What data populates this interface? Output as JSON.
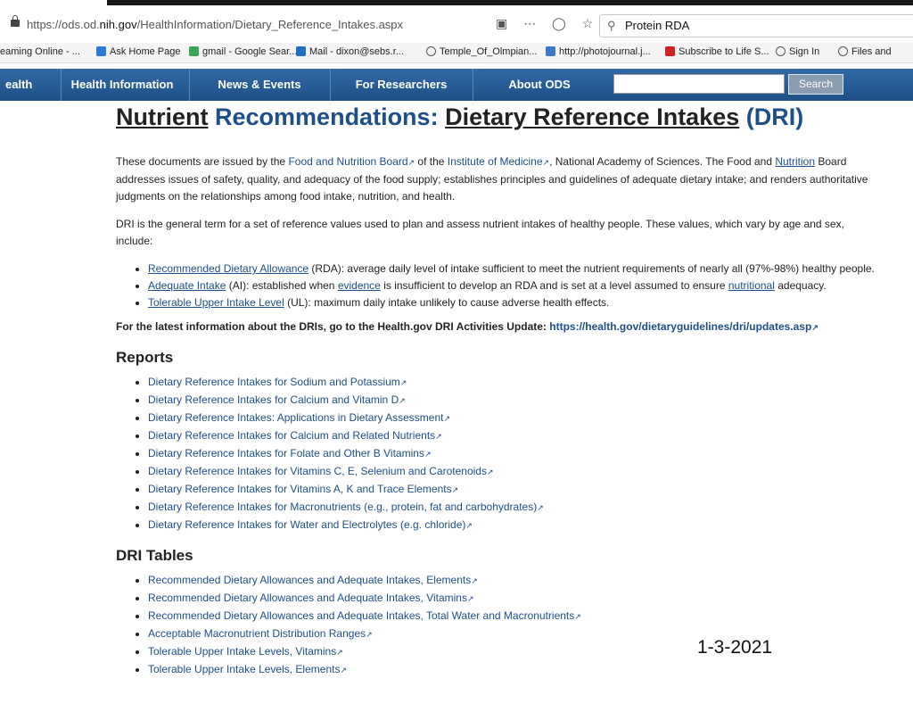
{
  "browser": {
    "url_prefix": "https://ods.od.",
    "url_domain": "nih.gov",
    "url_path": "/HealthInformation/Dietary_Reference_Intakes.aspx",
    "search_value": "Protein RDA",
    "icons": [
      "reader-icon",
      "more-icon",
      "pocket-icon",
      "star-icon"
    ]
  },
  "bookmarks": [
    {
      "label": "eaming Online - ...",
      "icon": "none"
    },
    {
      "label": "Ask Home Page",
      "icon": "search-icon",
      "color": "#2a7ad8"
    },
    {
      "label": "gmail - Google Sear...",
      "icon": "google-icon",
      "color": "#3aa757"
    },
    {
      "label": "Mail - dixon@sebs.r...",
      "icon": "outlook-icon",
      "color": "#1f6fc5"
    },
    {
      "label": "Temple_Of_Olmpian...",
      "icon": "globe-icon",
      "color": "#555555"
    },
    {
      "label": "http://photojournal.j...",
      "icon": "photo-icon",
      "color": "#3a78c8"
    },
    {
      "label": "Subscribe to Life S...",
      "icon": "life-icon",
      "color": "#d22222"
    },
    {
      "label": "Sign In",
      "icon": "globe-icon",
      "color": "#555555"
    },
    {
      "label": "Files and",
      "icon": "globe-icon",
      "color": "#555555"
    }
  ],
  "nav": {
    "items": [
      "ealth",
      "Health Information",
      "News & Events",
      "For Researchers",
      "About ODS"
    ],
    "search_button": "Search"
  },
  "page": {
    "title_1": "Nutrient",
    "title_2": "Recommendations:",
    "title_3": "Dietary Reference Intakes",
    "title_4": "(DRI)",
    "p1": {
      "t1": "These documents are issued by the ",
      "link1": "Food and Nutrition Board",
      "t2": " of the ",
      "link2": "Institute of Medicine",
      "t3": ", National Academy of Sciences. The Food and ",
      "link3": "Nutrition",
      "t4": " Board addresses issues of safety, quality, and adequacy of the food supply; establishes principles and guidelines of adequate dietary intake; and renders authoritative judgments on the relationships among food intake, nutrition, and health."
    },
    "p2": "DRI is the general term for a set of reference values used to plan and assess nutrient intakes of healthy people. These values, which vary by age and sex, include:",
    "defs": [
      {
        "link": "Recommended Dietary Allowance",
        "text": " (RDA): average daily level of intake sufficient to meet the nutrient requirements of nearly all (97%-98%) healthy people."
      },
      {
        "link": "Adequate Intake",
        "text_a": " (AI): established when ",
        "link2": "evidence",
        "text_b": " is insufficient to develop an RDA and is set at a level assumed to ensure ",
        "link3": "nutritional",
        "text_c": " adequacy."
      },
      {
        "link": "Tolerable Upper Intake Level",
        "text": " (UL): maximum daily intake unlikely to cause adverse health effects."
      }
    ],
    "update_text": "For the latest information about the DRIs, go to the Health.gov DRI Activities Update: ",
    "update_link": "https://health.gov/dietaryguidelines/dri/updates.asp",
    "reports_heading": "Reports",
    "reports": [
      "Dietary Reference Intakes for Sodium and Potassium",
      "Dietary Reference Intakes for Calcium and Vitamin D",
      "Dietary Reference Intakes: Applications in Dietary Assessment",
      "Dietary Reference Intakes for Calcium and Related Nutrients",
      "Dietary Reference Intakes for Folate and Other B Vitamins",
      "Dietary Reference Intakes for Vitamins C, E, Selenium and Carotenoids",
      "Dietary Reference Intakes for Vitamins A, K and Trace Elements",
      "Dietary Reference Intakes for Macronutrients (e.g., protein, fat and carbohydrates)",
      "Dietary Reference Intakes for Water and Electrolytes (e.g. chloride)"
    ],
    "tables_heading": "DRI Tables",
    "tables": [
      "Recommended Dietary Allowances and Adequate Intakes, Elements",
      "Recommended Dietary Allowances and Adequate Intakes, Vitamins",
      "Recommended Dietary Allowances and Adequate Intakes, Total Water and Macronutrients",
      "Acceptable Macronutrient Distribution Ranges",
      "Tolerable Upper Intake Levels, Vitamins",
      "Tolerable Upper Intake Levels, Elements"
    ]
  },
  "annotation": "1-3-2021"
}
